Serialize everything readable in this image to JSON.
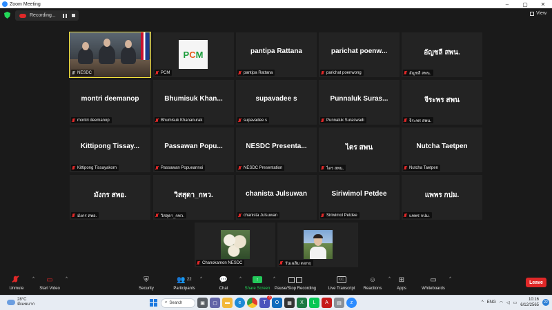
{
  "window": {
    "title": "Zoom Meeting",
    "minimize": "–",
    "maximize": "▢",
    "close": "✕"
  },
  "topbar": {
    "recording_label": "Recording...",
    "view_label": "View"
  },
  "tiles": [
    {
      "name": "",
      "label": "NESDC"
    },
    {
      "name": "",
      "label": "PCM",
      "logo": [
        "P",
        "C",
        "M"
      ]
    },
    {
      "name": "pantipa Rattana",
      "label": "pantipa Rattana"
    },
    {
      "name": "parichat poenw...",
      "label": "parichat poenwong"
    },
    {
      "name": "อัญชลี สพน.",
      "label": "อัญชลี สพน."
    },
    {
      "name": "montri deemanop",
      "label": "montri deemanop"
    },
    {
      "name": "Bhumisuk Khan...",
      "label": "Bhumisuk Khananurak"
    },
    {
      "name": "supavadee s",
      "label": "supavadee s"
    },
    {
      "name": "Punnaluk Suras...",
      "label": "Punnaluk Suraswadi"
    },
    {
      "name": "จีระพร สพน",
      "label": "จีระพร สพน."
    },
    {
      "name": "Kittipong Tissay...",
      "label": "Kittipong Tissayakorn"
    },
    {
      "name": "Passawan Popu...",
      "label": "Passawan Popueannoi"
    },
    {
      "name": "NESDC Presenta...",
      "label": "NESDC Presentation"
    },
    {
      "name": "ไตร สพน",
      "label": "ไตร สพน."
    },
    {
      "name": "Nutcha Taetpen",
      "label": "Nutcha Taetpen"
    },
    {
      "name": "มังกร สพอ.",
      "label": "มังกร สพอ."
    },
    {
      "name": "วิสสุดา_กพว.",
      "label": "วิสสุดา_กพว."
    },
    {
      "name": "chanista Julsuwan",
      "label": "chanista Julsuwan"
    },
    {
      "name": "Siriwimol Petdee",
      "label": "Siriwimol Petdee"
    },
    {
      "name": "แพพร กปม.",
      "label": "แพพร กปม."
    },
    {
      "name": "",
      "label": "Chanokamon NESDC"
    },
    {
      "name": "",
      "label": "วันเฉลิม ดอกฤ"
    }
  ],
  "controls": {
    "unmute": "Unmute",
    "start_video": "Start Video",
    "security": "Security",
    "participants": "Participants",
    "participants_count": "22",
    "chat": "Chat",
    "share_screen": "Share Screen",
    "pause_recording": "Pause/Stop Recording",
    "live_transcript": "Live Transcript",
    "reactions": "Reactions",
    "apps": "Apps",
    "whiteboards": "Whiteboards",
    "leave": "Leave",
    "cc_text": "CC"
  },
  "taskbar": {
    "temperature": "28°C",
    "weather_desc": "มีเมฆมาก",
    "search_label": "Search",
    "language": "ENG",
    "time": "10:16",
    "date": "6/12/2565",
    "notification_count": "22",
    "app_badge": "3"
  },
  "colors": {
    "accent": "#2d8cff",
    "active_speaker": "#f5e43b",
    "muted": "#e02828",
    "share": "#23c95a",
    "leave": "#e02828"
  }
}
